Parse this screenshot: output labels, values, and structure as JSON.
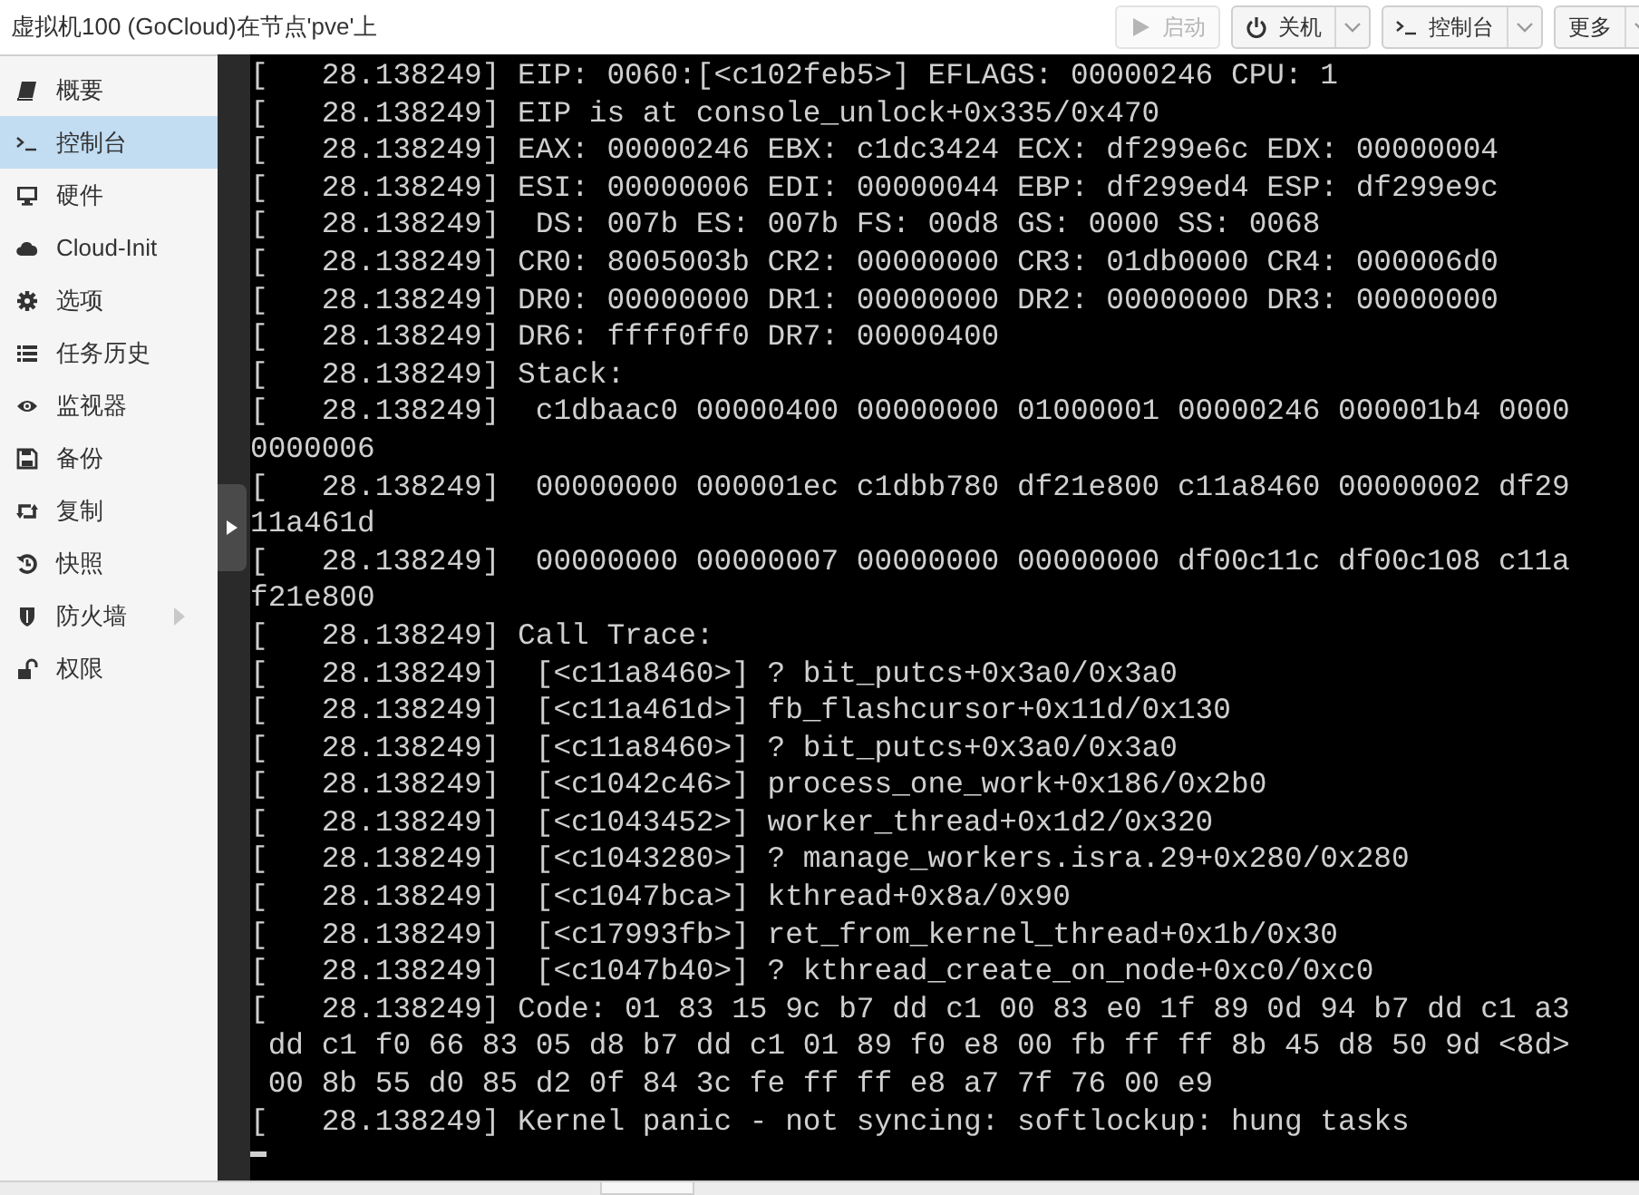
{
  "window": {
    "title": "虚拟机100 (GoCloud)在节点'pve'上"
  },
  "toolbar": [
    {
      "label": "启动",
      "kind": "play",
      "disabled": true,
      "dropdown": false
    },
    {
      "label": "关机",
      "kind": "power",
      "disabled": false,
      "dropdown": true
    },
    {
      "label": "控制台",
      "kind": "terminal",
      "disabled": false,
      "dropdown": true
    },
    {
      "label": "更多",
      "kind": "menu",
      "disabled": false,
      "dropdown": true
    }
  ],
  "sidebar": {
    "items": [
      {
        "label": "概要",
        "kind": "book",
        "selected": false,
        "expandable": false
      },
      {
        "label": "控制台",
        "kind": "terminal",
        "selected": true,
        "expandable": false
      },
      {
        "label": "硬件",
        "kind": "monitor",
        "selected": false,
        "expandable": false
      },
      {
        "label": "Cloud-Init",
        "kind": "cloud",
        "selected": false,
        "expandable": false
      },
      {
        "label": "选项",
        "kind": "gear",
        "selected": false,
        "expandable": false
      },
      {
        "label": "任务历史",
        "kind": "list",
        "selected": false,
        "expandable": false
      },
      {
        "label": "监视器",
        "kind": "eye",
        "selected": false,
        "expandable": false
      },
      {
        "label": "备份",
        "kind": "floppy",
        "selected": false,
        "expandable": false
      },
      {
        "label": "复制",
        "kind": "retweet",
        "selected": false,
        "expandable": false
      },
      {
        "label": "快照",
        "kind": "history",
        "selected": false,
        "expandable": false
      },
      {
        "label": "防火墙",
        "kind": "shield",
        "selected": false,
        "expandable": true
      },
      {
        "label": "权限",
        "kind": "unlock",
        "selected": false,
        "expandable": false
      }
    ]
  },
  "console": {
    "lines": [
      "[   28.138249] EIP: 0060:[<c102feb5>] EFLAGS: 00000246 CPU: 1",
      "[   28.138249] EIP is at console_unlock+0x335/0x470",
      "[   28.138249] EAX: 00000246 EBX: c1dc3424 ECX: df299e6c EDX: 00000004",
      "[   28.138249] ESI: 00000006 EDI: 00000044 EBP: df299ed4 ESP: df299e9c",
      "[   28.138249]  DS: 007b ES: 007b FS: 00d8 GS: 0000 SS: 0068",
      "[   28.138249] CR0: 8005003b CR2: 00000000 CR3: 01db0000 CR4: 000006d0",
      "[   28.138249] DR0: 00000000 DR1: 00000000 DR2: 00000000 DR3: 00000000",
      "[   28.138249] DR6: ffff0ff0 DR7: 00000400",
      "[   28.138249] Stack:",
      "[   28.138249]  c1dbaac0 00000400 00000000 01000001 00000246 000001b4 0000",
      "0000006",
      "[   28.138249]  00000000 000001ec c1dbb780 df21e800 c11a8460 00000002 df29",
      "11a461d",
      "[   28.138249]  00000000 00000007 00000000 00000000 df00c11c df00c108 c11a",
      "f21e800",
      "[   28.138249] Call Trace:",
      "[   28.138249]  [<c11a8460>] ? bit_putcs+0x3a0/0x3a0",
      "[   28.138249]  [<c11a461d>] fb_flashcursor+0x11d/0x130",
      "[   28.138249]  [<c11a8460>] ? bit_putcs+0x3a0/0x3a0",
      "[   28.138249]  [<c1042c46>] process_one_work+0x186/0x2b0",
      "[   28.138249]  [<c1043452>] worker_thread+0x1d2/0x320",
      "[   28.138249]  [<c1043280>] ? manage_workers.isra.29+0x280/0x280",
      "[   28.138249]  [<c1047bca>] kthread+0x8a/0x90",
      "[   28.138249]  [<c17993fb>] ret_from_kernel_thread+0x1b/0x30",
      "[   28.138249]  [<c1047b40>] ? kthread_create_on_node+0xc0/0xc0",
      "[   28.138249] Code: 01 83 15 9c b7 dd c1 00 83 e0 1f 89 0d 94 b7 dd c1 a3",
      " dd c1 f0 66 83 05 d8 b7 dd c1 01 89 f0 e8 00 fb ff ff 8b 45 d8 50 9d <8d>",
      " 00 8b 55 d0 85 d2 0f 84 3c fe ff ff e8 a7 7f 76 00 e9",
      "[   28.138249] Kernel panic - not syncing: softlockup: hung tasks"
    ]
  }
}
